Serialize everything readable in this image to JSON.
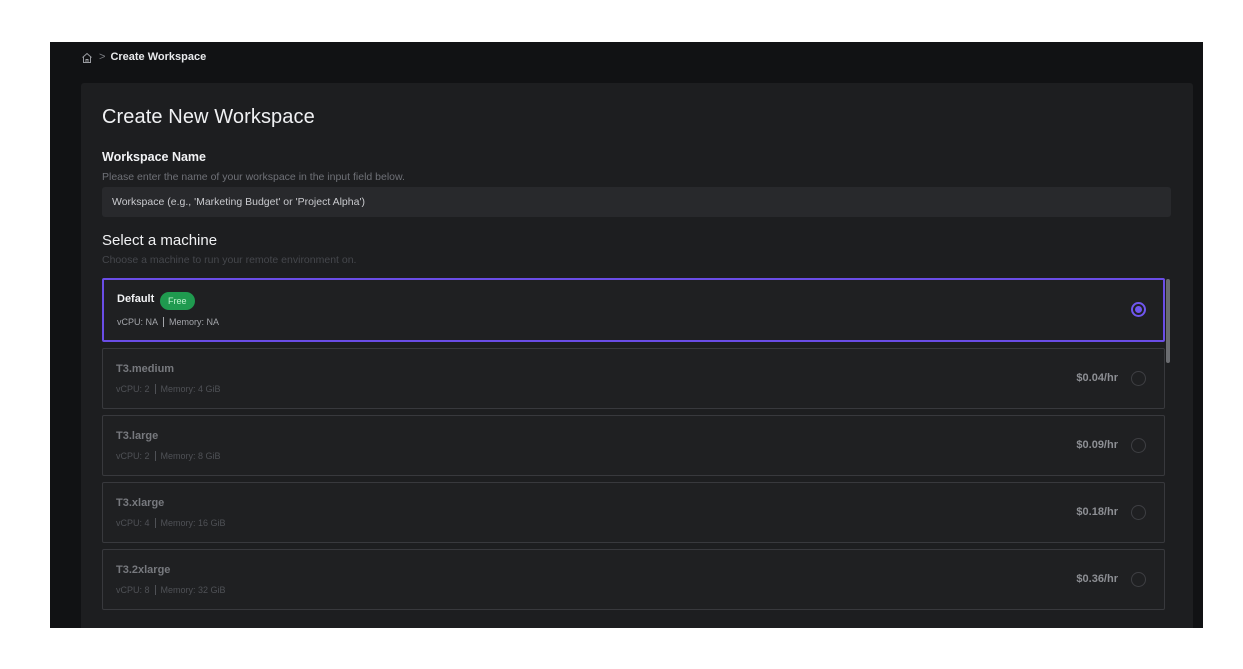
{
  "breadcrumb": {
    "home_icon": "home-icon",
    "separator": ">",
    "current": "Create Workspace"
  },
  "page": {
    "title": "Create New Workspace"
  },
  "workspace_name": {
    "label": "Workspace Name",
    "help": "Please enter the name of your workspace in the input field below.",
    "placeholder": "Workspace (e.g., 'Marketing Budget' or 'Project Alpha')",
    "value": ""
  },
  "machine_section": {
    "heading": "Select a machine",
    "help": "Choose a machine to run your remote environment on.",
    "selected": "Default",
    "machines": [
      {
        "name": "Default",
        "badge": "Free",
        "vcpu": "vCPU: NA",
        "memory": "Memory: NA",
        "price": "",
        "selected": true
      },
      {
        "name": "T3.medium",
        "badge": "",
        "vcpu": "vCPU: 2",
        "memory": "Memory: 4 GiB",
        "price": "$0.04/hr",
        "selected": false
      },
      {
        "name": "T3.large",
        "badge": "",
        "vcpu": "vCPU: 2",
        "memory": "Memory: 8 GiB",
        "price": "$0.09/hr",
        "selected": false
      },
      {
        "name": "T3.xlarge",
        "badge": "",
        "vcpu": "vCPU: 4",
        "memory": "Memory: 16 GiB",
        "price": "$0.18/hr",
        "selected": false
      },
      {
        "name": "T3.2xlarge",
        "badge": "",
        "vcpu": "vCPU: 8",
        "memory": "Memory: 32 GiB",
        "price": "$0.36/hr",
        "selected": false
      }
    ]
  },
  "colors": {
    "accent": "#6a4de6",
    "badge_green": "#1f9a4f",
    "panel_bg": "#1d1e20",
    "app_bg": "#111214"
  }
}
